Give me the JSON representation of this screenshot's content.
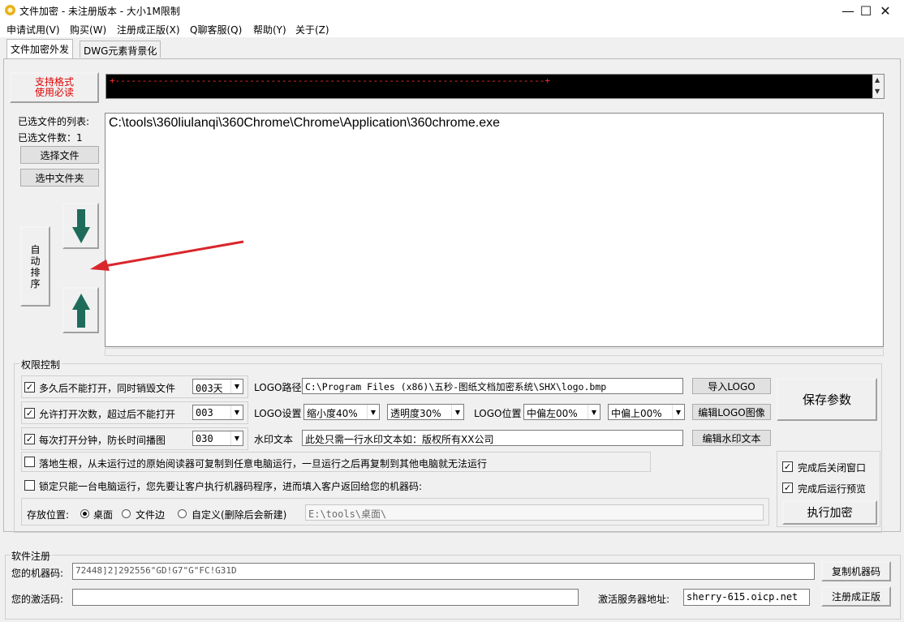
{
  "window": {
    "title": "文件加密 - 未注册版本 - 大小1M限制",
    "min_label": "—",
    "max_label": "☐",
    "close_label": "✕"
  },
  "menu": [
    "申请试用(V)",
    "购买(W)",
    "注册成正版(X)",
    "Q聊客服(Q)",
    "帮助(Y)",
    "关于(Z)"
  ],
  "tabs": [
    "文件加密外发",
    "DWG元素背景化"
  ],
  "top": {
    "format_btn_line1": "支持格式",
    "format_btn_line2": "使用必读",
    "banner": "+--------------------------------------------------------------------------------+"
  },
  "files": {
    "list_label": "已选文件的列表:",
    "count_label": "已选文件数：1",
    "select_file_btn": "选择文件",
    "select_folder_btn": "选中文件夹",
    "auto_sort_btn": "自\n动\n排\n序",
    "items": [
      "C:\\tools\\360liulanqi\\360Chrome\\Chrome\\Application\\360chrome.exe"
    ]
  },
  "perm": {
    "legend": "权限控制",
    "row1_label": "多久后不能打开，同时销毁文件",
    "row1_value": "003天",
    "row2_label": "允许打开次数，超过后不能打开",
    "row2_value": "003",
    "row3_label": "每次打开分钟，防长时间播图",
    "row3_value": "030",
    "logo_path_label": "LOGO路径",
    "logo_path_value": "C:\\Program Files (x86)\\五秒-图纸文档加密系统\\SHX\\logo.bmp",
    "import_logo_btn": "导入LOGO",
    "logo_settings_label": "LOGO设置",
    "scale_value": "缩小度40%",
    "opacity_value": "透明度30%",
    "logo_position_label": "LOGO位置",
    "pos_x_value": "中偏左00%",
    "pos_y_value": "中偏上00%",
    "edit_logo_btn": "编辑LOGO图像",
    "watermark_label": "水印文本",
    "watermark_value": "此处只需一行水印文本如：版权所有XX公司",
    "edit_watermark_btn": "编辑水印文本",
    "save_params_btn": "保存参数",
    "root_label": "落地生根，从未运行过的原始阅读器可复制到任意电脑运行，一旦运行之后再复制到其他电脑就无法运行",
    "lock_label": "锁定只能一台电脑运行，您先要让客户执行机器码程序，进而填入客户返回给您的机器码:",
    "close_after_label": "完成后关闭窗口",
    "preview_after_label": "完成后运行预览",
    "execute_btn": "执行加密",
    "save_location_label": "存放位置:",
    "opt_desktop": "桌面",
    "opt_file_side": "文件边",
    "opt_custom": "自定义(删除后会新建)",
    "custom_path": "E:\\tools\\桌面\\"
  },
  "reg": {
    "legend": "软件注册",
    "machine_label": "您的机器码:",
    "machine_value": "72448]2]292556\"GD!G7\"G\"FC!G31D",
    "copy_btn": "复制机器码",
    "activation_label": "您的激活码:",
    "activation_value": "",
    "server_label": "激活服务器地址:",
    "server_value": "sherry-615.oicp.net",
    "register_btn": "注册成正版"
  },
  "colors": {
    "arrow_green": "#1f6b5a",
    "annotation_red": "#d9262c",
    "banner_bg": "#000000",
    "banner_fg": "#ff3030",
    "format_btn_text": "#e00000"
  }
}
